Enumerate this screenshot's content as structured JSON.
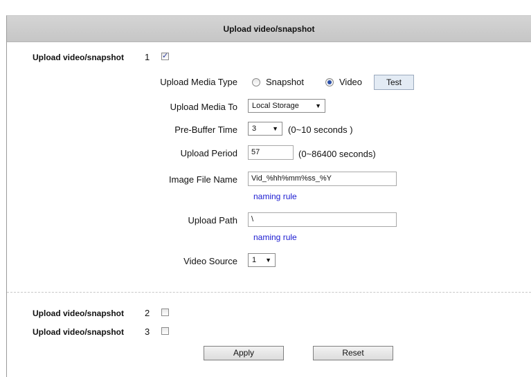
{
  "header": {
    "title": "Upload video/snapshot"
  },
  "group1": {
    "label": "Upload video/snapshot",
    "index": "1",
    "checked": true
  },
  "form": {
    "media_type_label": "Upload Media Type",
    "media_type_options": [
      "Snapshot",
      "Video"
    ],
    "media_type_selected": "Video",
    "test_label": "Test",
    "media_to_label": "Upload Media To",
    "media_to_value": "Local Storage",
    "prebuffer_label": "Pre-Buffer Time",
    "prebuffer_value": "3",
    "prebuffer_hint": "(0~10 seconds )",
    "period_label": "Upload Period",
    "period_value": "57",
    "period_hint": "(0~86400 seconds)",
    "filename_label": "Image File Name",
    "filename_value": "Vid_%hh%mm%ss_%Y",
    "naming_rule": "naming rule",
    "path_label": "Upload Path",
    "path_value": "\\",
    "source_label": "Video Source",
    "source_value": "1"
  },
  "group2": {
    "label": "Upload video/snapshot",
    "index": "2",
    "checked": false
  },
  "group3": {
    "label": "Upload video/snapshot",
    "index": "3",
    "checked": false
  },
  "actions": {
    "apply": "Apply",
    "reset": "Reset"
  }
}
